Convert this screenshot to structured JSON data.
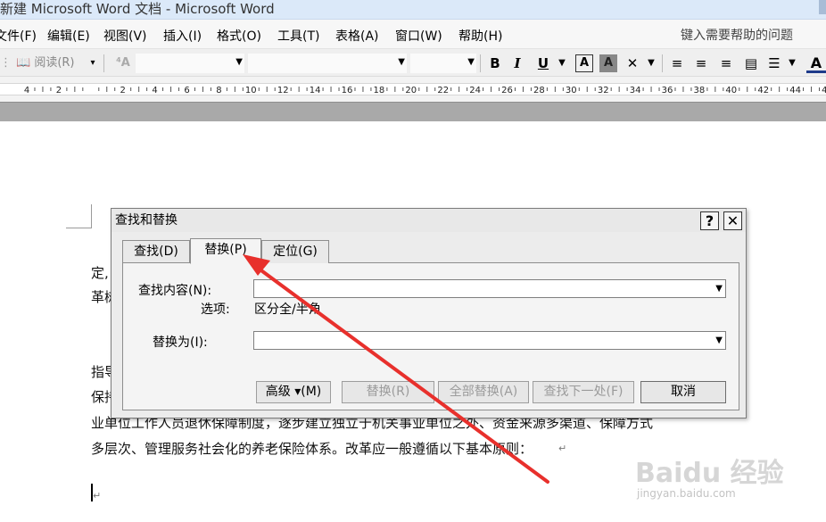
{
  "window": {
    "title": "新建 Microsoft Word 文档 - Microsoft Word"
  },
  "menubar": {
    "items": [
      "文件(F)",
      "编辑(E)",
      "视图(V)",
      "插入(I)",
      "格式(O)",
      "工具(T)",
      "表格(A)",
      "窗口(W)",
      "帮助(H)"
    ],
    "help_placeholder": "键入需要帮助的问题"
  },
  "toolbar": {
    "read_label": "阅读(R)",
    "bold": "B",
    "italic": "I",
    "underline": "U",
    "char_border": "A",
    "char_shading": "A"
  },
  "ruler": {
    "labels": [
      "4",
      "2",
      "",
      "2",
      "4",
      "6",
      "8",
      "10",
      "12",
      "14",
      "16",
      "18",
      "20",
      "22",
      "24",
      "26",
      "28",
      "30",
      "32",
      "34",
      "36",
      "38",
      "40",
      "42",
      "44",
      "46"
    ]
  },
  "document": {
    "line1": "定,",
    "line2": "革树",
    "line3": "指导",
    "line4": "保持",
    "line5": "业单位工作人员退休保障制度，逐步建立独立于机关事业单位之外、资金来源多渠道、保障方式",
    "line6": "多层次、管理服务社会化的养老保险体系。改革应一般遵循以下基本原则：",
    "para_mark": "↵"
  },
  "dialog": {
    "title": "查找和替换",
    "help_btn": "?",
    "close_btn": "✕",
    "tabs": [
      {
        "label": "查找(D)"
      },
      {
        "label": "替换(P)"
      },
      {
        "label": "定位(G)"
      }
    ],
    "find_label": "查找内容(N):",
    "find_value": "",
    "options_label": "选项:",
    "options_value": "区分全/半角",
    "replace_label": "替换为(I):",
    "replace_value": "",
    "buttons": {
      "more": "高级 ▾(M)",
      "replace": "替换(R)",
      "replace_all": "全部替换(A)",
      "find_next": "查找下一处(F)",
      "cancel": "取消"
    }
  },
  "annotation": {
    "arrow_color": "#e8302c"
  },
  "watermark": {
    "logo": "Baidu 经验",
    "url": "jingyan.baidu.com"
  }
}
